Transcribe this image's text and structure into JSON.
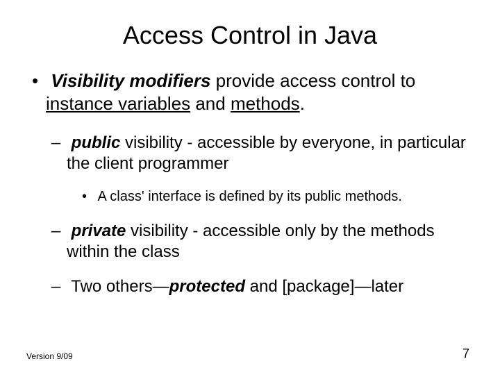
{
  "title": "Access Control in Java",
  "bullet1": {
    "lead": "Visibility modifiers",
    "mid1": " provide access control to ",
    "u1": "instance variables",
    "mid2": " and ",
    "u2": "methods",
    "tail": "."
  },
  "sub": [
    {
      "kw": "public",
      "rest": " visibility - accessible by everyone, in particular the client programmer"
    },
    {
      "kw": "private",
      "rest": " visibility - accessible only by the methods within the class"
    }
  ],
  "subsub": "A class' interface is defined by its public methods.",
  "others": {
    "pre": "Two others—",
    "kw": "protected",
    "post": " and [package]—later"
  },
  "footer": {
    "version": "Version 9/09",
    "page": "7"
  }
}
